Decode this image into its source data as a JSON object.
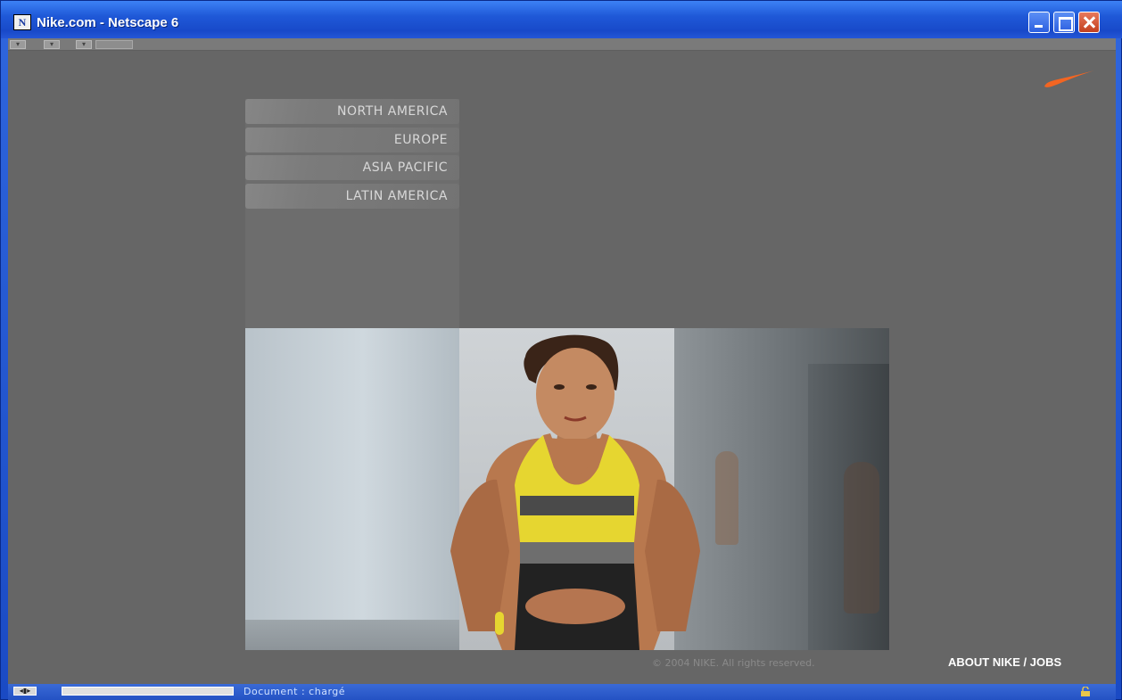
{
  "window": {
    "title": "Nike.com - Netscape 6",
    "app_icon": "N"
  },
  "colors": {
    "page_bg": "#666666",
    "swoosh": "#f26522",
    "titlebar": "#2f66de"
  },
  "nav": {
    "regions": [
      {
        "label": "NORTH AMERICA"
      },
      {
        "label": "EUROPE"
      },
      {
        "label": "ASIA PACIFIC"
      },
      {
        "label": "LATIN AMERICA"
      }
    ]
  },
  "footer": {
    "copyright": "© 2004 NIKE. All rights reserved.",
    "about_link": "ABOUT NIKE / JOBS"
  },
  "status": {
    "text": "Document : chargé"
  },
  "icons": [
    "nike-swoosh-icon",
    "minimize-icon",
    "maximize-icon",
    "close-icon",
    "lock-icon",
    "netscape-app-icon"
  ]
}
